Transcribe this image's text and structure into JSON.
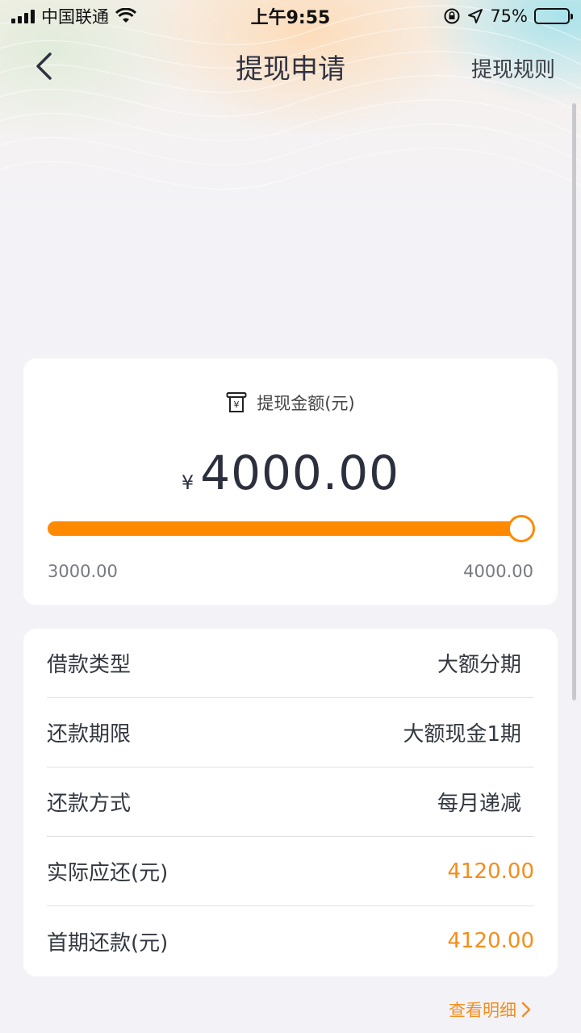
{
  "status_bar": {
    "carrier": "中国联通",
    "time": "上午9:55",
    "battery": "75%",
    "battery_level": 0.75,
    "icons": [
      "signal-icon",
      "wifi-icon",
      "rotation-lock-icon",
      "location-icon",
      "battery-icon"
    ]
  },
  "nav": {
    "title": "提现申请",
    "right_action": "提现规则",
    "back_icon": "chevron-left-icon"
  },
  "amount_card": {
    "label": "提现金额(元)",
    "label_icon": "cash-receipt-icon",
    "currency_symbol": "¥",
    "value": "4000.00",
    "min": "3000.00",
    "max": "4000.00",
    "slider_fraction": 1.0,
    "accent_color": "#ff8a00"
  },
  "details": {
    "rows": [
      {
        "label": "借款类型",
        "value": "大额分期",
        "accent": false
      },
      {
        "label": "还款期限",
        "value": "大额现金1期",
        "accent": false
      },
      {
        "label": "还款方式",
        "value": "每月递减",
        "accent": false
      },
      {
        "label": "实际应还(元)",
        "value": "4120.00",
        "accent": true
      },
      {
        "label": "首期还款(元)",
        "value": "4120.00",
        "accent": true
      }
    ],
    "accent_color": "#f58d1d"
  },
  "view_detail": {
    "label": "查看明细",
    "icon": "chevron-right-icon"
  }
}
